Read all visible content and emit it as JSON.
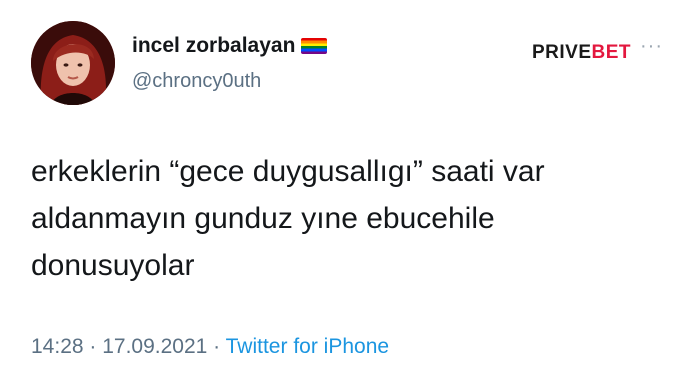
{
  "user": {
    "display_name": "incel zorbalayan",
    "flag_icon": "rainbow-flag-icon",
    "handle": "@chroncy0uth"
  },
  "watermark": {
    "part1": "PRIVE",
    "part2": "BET",
    "accent_color": "#e3173e"
  },
  "more_icon": "···",
  "tweet": {
    "lines": [
      "erkeklerin “gece duygusallıgı” saati var",
      "aldanmayın gunduz yıne ebucehile",
      "donusuyolar"
    ]
  },
  "meta": {
    "time": "14:28",
    "sep1": " · ",
    "date": "17.09.2021",
    "sep2": " · ",
    "source": "Twitter for iPhone"
  }
}
